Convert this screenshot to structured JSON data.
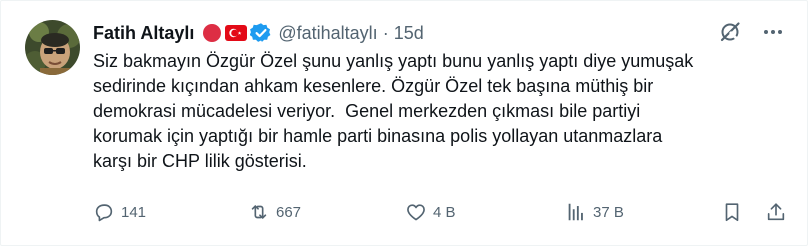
{
  "tweet": {
    "author_name": "Fatih Altaylı",
    "handle": "@fatihaltaylı",
    "separator": "·",
    "time": "15d",
    "text": "Siz bakmayın Özgür Özel şunu yanlış yaptı bunu yanlış yaptı diye yumuşak\nsedirinde kıçından ahkam kesenlere. Özgür Özel tek başına müthiş bir\ndemokrasi mücadelesi veriyor.  Genel merkezden çıkması bile partiyi\nkorumak için yaptığı bir hamle parti binasına polis yollayan utanmazlara\nkarşı bir CHP lilik gösterisi."
  },
  "actions": {
    "replies": "141",
    "reposts": "667",
    "likes": "4 B",
    "views": "37 B"
  },
  "icons": {
    "badge_left": "red-circle-icon",
    "badge_flag": "turkey-flag-icon",
    "verified": "verified-badge-icon",
    "grok": "grok-icon",
    "more": "more-icon",
    "reply": "reply-icon",
    "repost": "repost-icon",
    "like": "heart-icon",
    "views": "views-icon",
    "bookmark": "bookmark-icon",
    "share": "share-icon"
  },
  "colors": {
    "verified_blue": "#1d9bf0",
    "secondary_text": "#536471",
    "flag_red": "#e30a17",
    "emoji_red": "#dd2e44"
  }
}
